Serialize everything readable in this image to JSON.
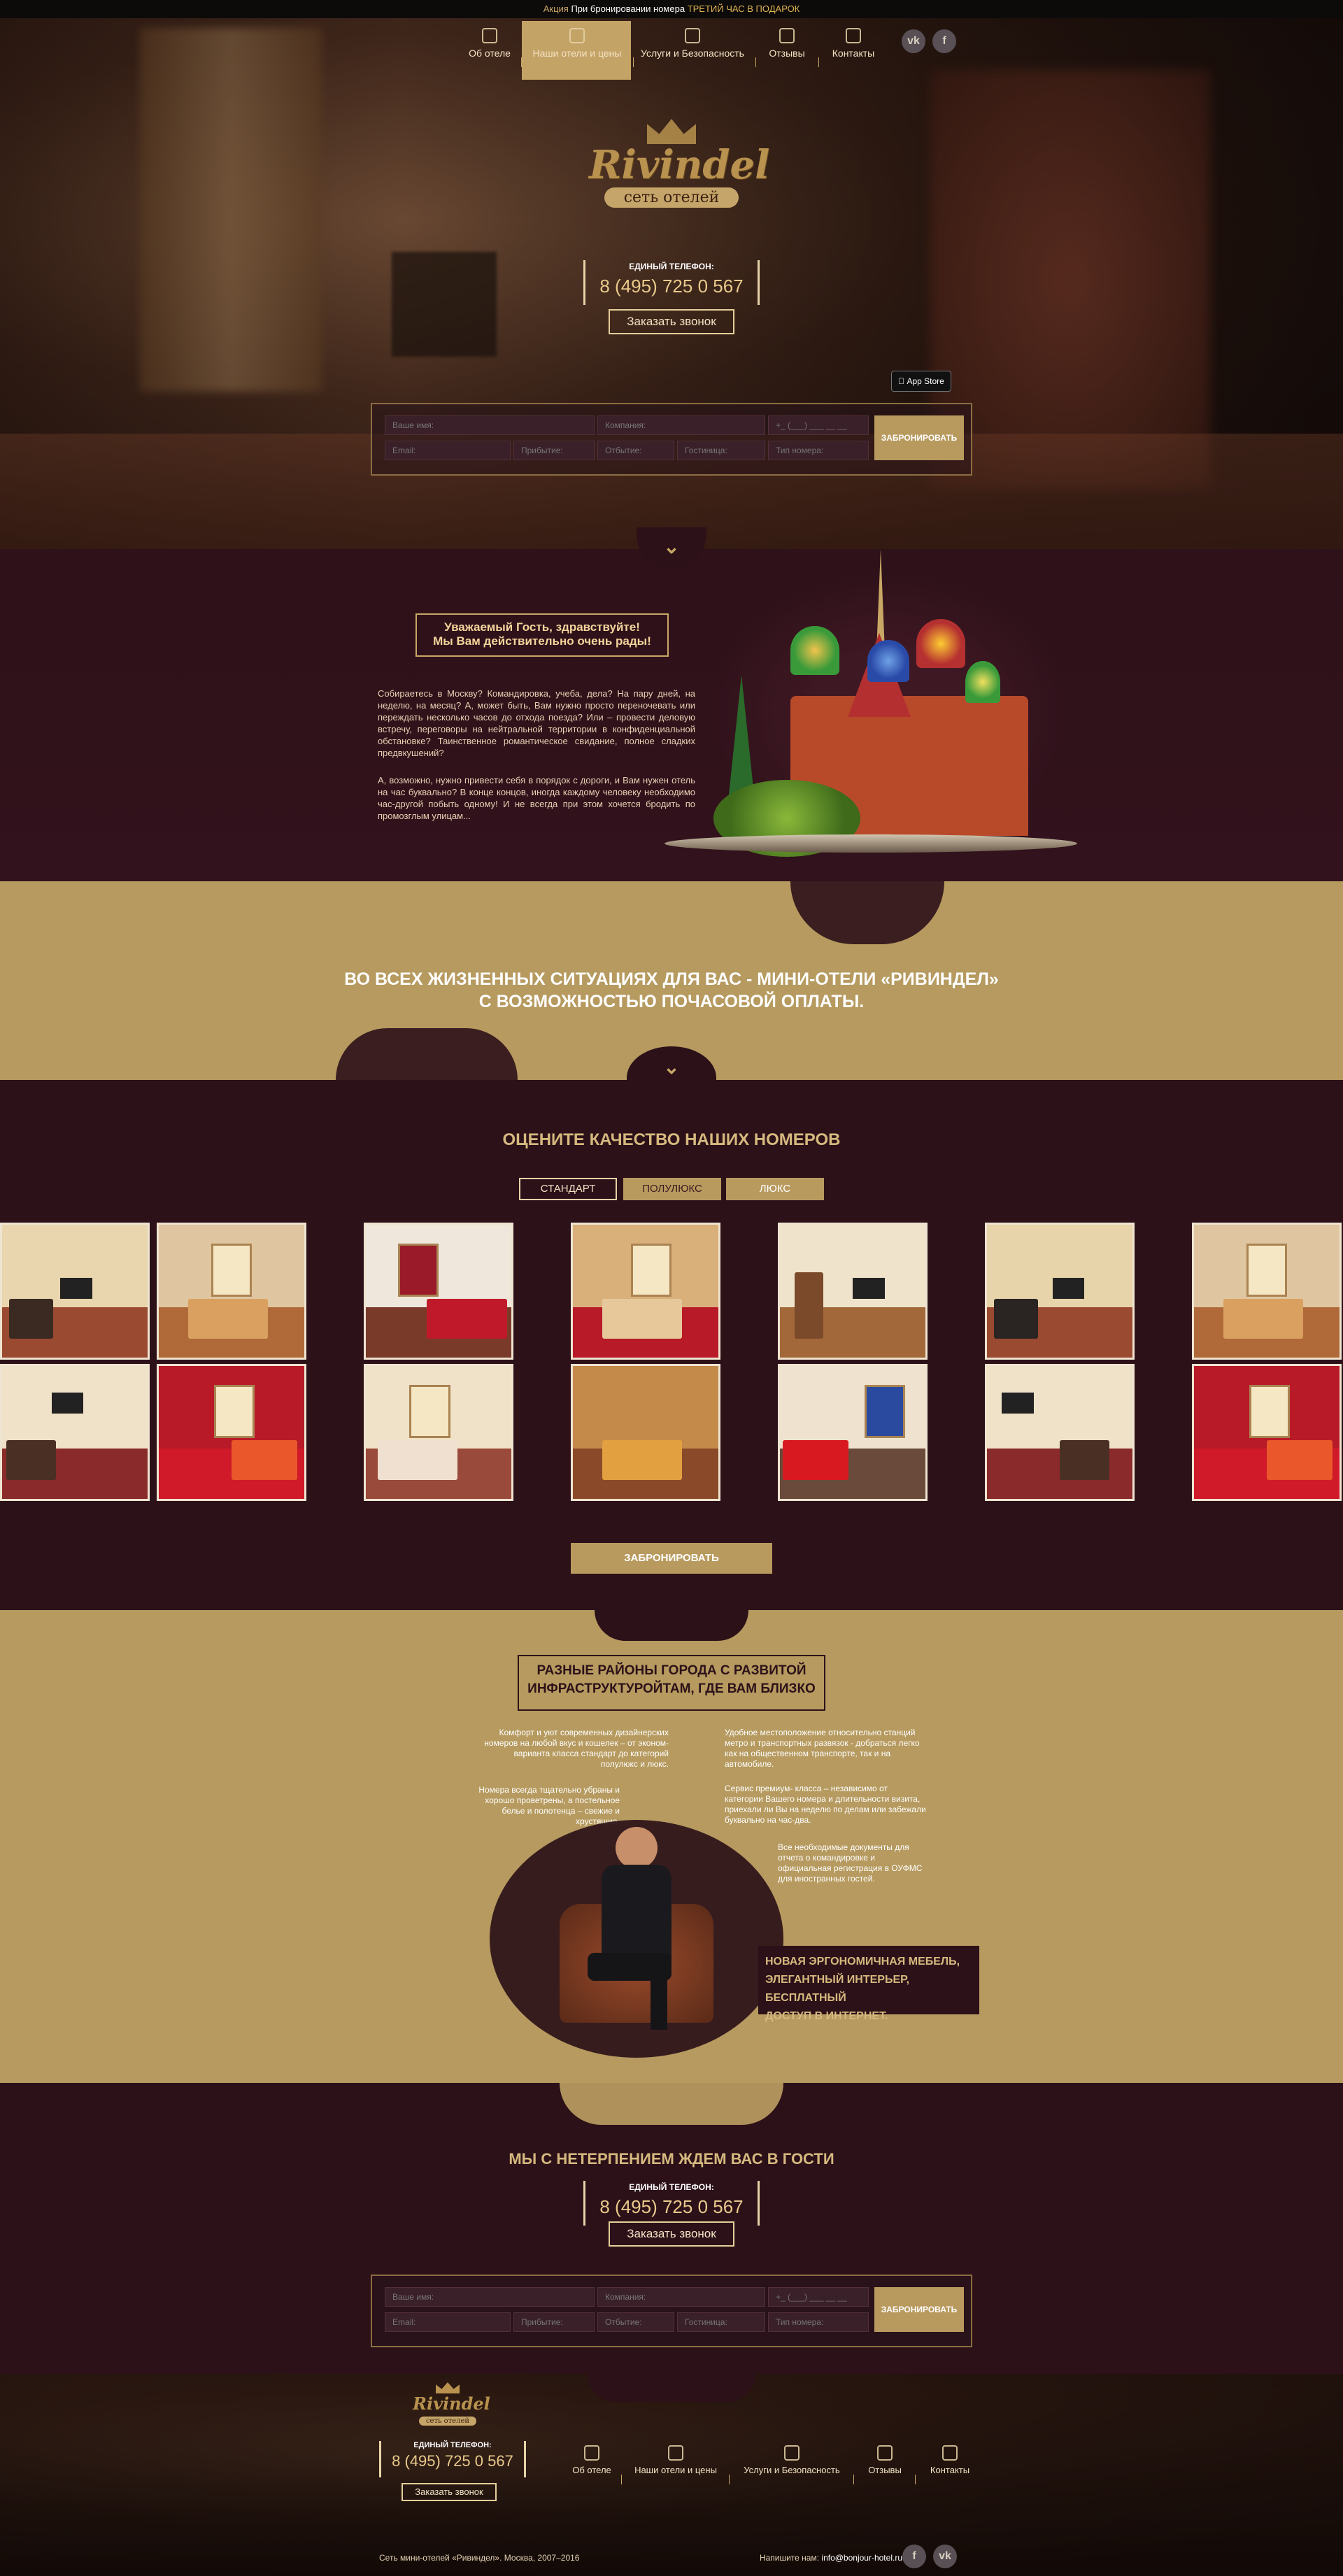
{
  "topbar": {
    "promo_prefix": "Акция",
    "promo_text": "При бронировании номера",
    "promo_highlight": "ТРЕТИЙ ЧАС В ПОДАРОК"
  },
  "nav": {
    "items": [
      {
        "label": "Об отеле",
        "icon": "home-icon"
      },
      {
        "label": "Наши отели и цены",
        "icon": "hotel-icon"
      },
      {
        "label": "Услуги и Безопасность",
        "icon": "services-icon"
      },
      {
        "label": "Отзывы",
        "icon": "reviews-icon"
      },
      {
        "label": "Контакты",
        "icon": "contacts-icon"
      }
    ],
    "active_index": 1,
    "social": [
      "vk",
      "f"
    ]
  },
  "hero": {
    "logo_text": "Rivindel",
    "logo_sub": "сеть отелей",
    "phone_label": "ЕДИНЫЙ ТЕЛЕФОН:",
    "phone": "8 (495) 725 0 567",
    "callback_btn": "Заказать звонок",
    "appstore": "App Store"
  },
  "booking_form": {
    "name_ph": "Ваше имя:",
    "company_ph": "Компания:",
    "phone_ph": "+_ (___) ___ __ __",
    "email_ph": "Email:",
    "arrive_ph": "Прибытие:",
    "depart_ph": "Отбытие:",
    "hotel_ph": "Гостиница:",
    "roomtype_ph": "Тип номера:",
    "submit": "ЗАБРОНИРОВАТЬ"
  },
  "welcome": {
    "title_line1": "Уважаемый Гость, здравствуйте!",
    "title_line2": "Мы Вам действительно очень рады!",
    "para1": "Собираетесь в Москву? Командировка, учеба, дела? На пару дней, на неделю, на месяц? А, может быть, Вам нужно просто переночевать или переждать несколько часов до отхода поезда? Или – провести деловую встречу, переговоры на нейтральной территории в конфиденциальной обстановке? Таинственное романтическое свидание, полное сладких предвкушений?",
    "para2": "А, возможно, нужно привести себя в порядок с дороги, и Вам нужен отель на час буквально? В конце концов, иногда каждому человеку необходимо час-другой побыть одному! И не всегда при этом хочется бродить по промозглым улицам..."
  },
  "banner": {
    "line1": "ВО ВСЕХ ЖИЗНЕННЫХ СИТУАЦИЯХ ДЛЯ ВАС - МИНИ-ОТЕЛИ «РИВИНДЕЛ»",
    "line2": "С ВОЗМОЖНОСТЬЮ ПОЧАСОВОЙ ОПЛАТЫ."
  },
  "rooms": {
    "title": "ОЦЕНИТЕ КАЧЕСТВО НАШИХ НОМЕРОВ",
    "tabs": [
      "СТАНДАРТ",
      "ПОЛУЛЮКС",
      "ЛЮКС"
    ],
    "active_tab": 1,
    "book_btn": "ЗАБРОНИРОВАТЬ"
  },
  "districts": {
    "title_line1": "РАЗНЫЕ РАЙОНЫ ГОРОДА С РАЗВИТОЙ",
    "title_line2": "ИНФРАСТРУКТУРОЙТАМ, ГДЕ ВАМ БЛИЗКО",
    "left1": "Комфорт и уют современных дизайнерских номеров на любой вкус и кошелек – от эконом-варианта класса стандарт до категорий полулюкс и люкс.",
    "left2": "Номера всегда тщательно убраны и хорошо проветрены, а постельное белье и полотенца – свежие и хрустящие.",
    "right1": "Удобное местоположение относительно станций метро и транспортных развязок - добраться легко как на общественном транспорте, так и на автомобиле.",
    "right2": "Сервис премиум- класса – независимо от категории Вашего номера и длительности визита, приехали ли Вы на неделю по делам или забежали буквально на час-два.",
    "right3": "Все необходимые документы для отчета о командировке и официальная регистрация в ОУФМС для иностранных гостей.",
    "feature_line1": "НОВАЯ ЭРГОНОМИЧНАЯ МЕБЕЛЬ,",
    "feature_line2": "ЭЛЕГАНТНЫЙ ИНТЕРЬЕР, БЕСПЛАТНЫЙ",
    "feature_line3": "ДОСТУП В ИНТЕРНЕТ."
  },
  "invite": {
    "title": "МЫ С НЕТЕРПЕНИЕМ ЖДЕМ ВАС В ГОСТИ",
    "phone_label": "ЕДИНЫЙ ТЕЛЕФОН:",
    "phone": "8 (495) 725 0 567",
    "callback_btn": "Заказать звонок"
  },
  "footer": {
    "logo_text": "Rivindel",
    "logo_sub": "сеть отелей",
    "phone_label": "ЕДИНЫЙ ТЕЛЕФОН:",
    "phone": "8 (495) 725 0 567",
    "callback_btn": "Заказать звонок",
    "copyright": "Сеть мини-отелей «Ривиндел». Москва, 2007–2016",
    "write_label": "Напишите нам:",
    "email": "info@bonjour-hotel.ru"
  }
}
